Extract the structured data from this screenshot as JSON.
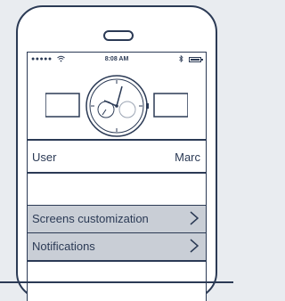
{
  "status_bar": {
    "signal": "●●●●●",
    "wifi_icon": "wifi-icon",
    "time": "8:08 AM",
    "bluetooth_icon": "bluetooth-icon",
    "battery_icon": "battery-icon"
  },
  "settings": {
    "user_label": "User",
    "user_value": "Marc",
    "items": [
      {
        "label": "Screens customization",
        "icon": "chevron-right-icon"
      },
      {
        "label": "Notifications",
        "icon": "chevron-right-icon"
      }
    ]
  },
  "colors": {
    "ink": "#2b3a55",
    "row_highlight": "#c9ced6",
    "background": "#e9ecf0"
  }
}
